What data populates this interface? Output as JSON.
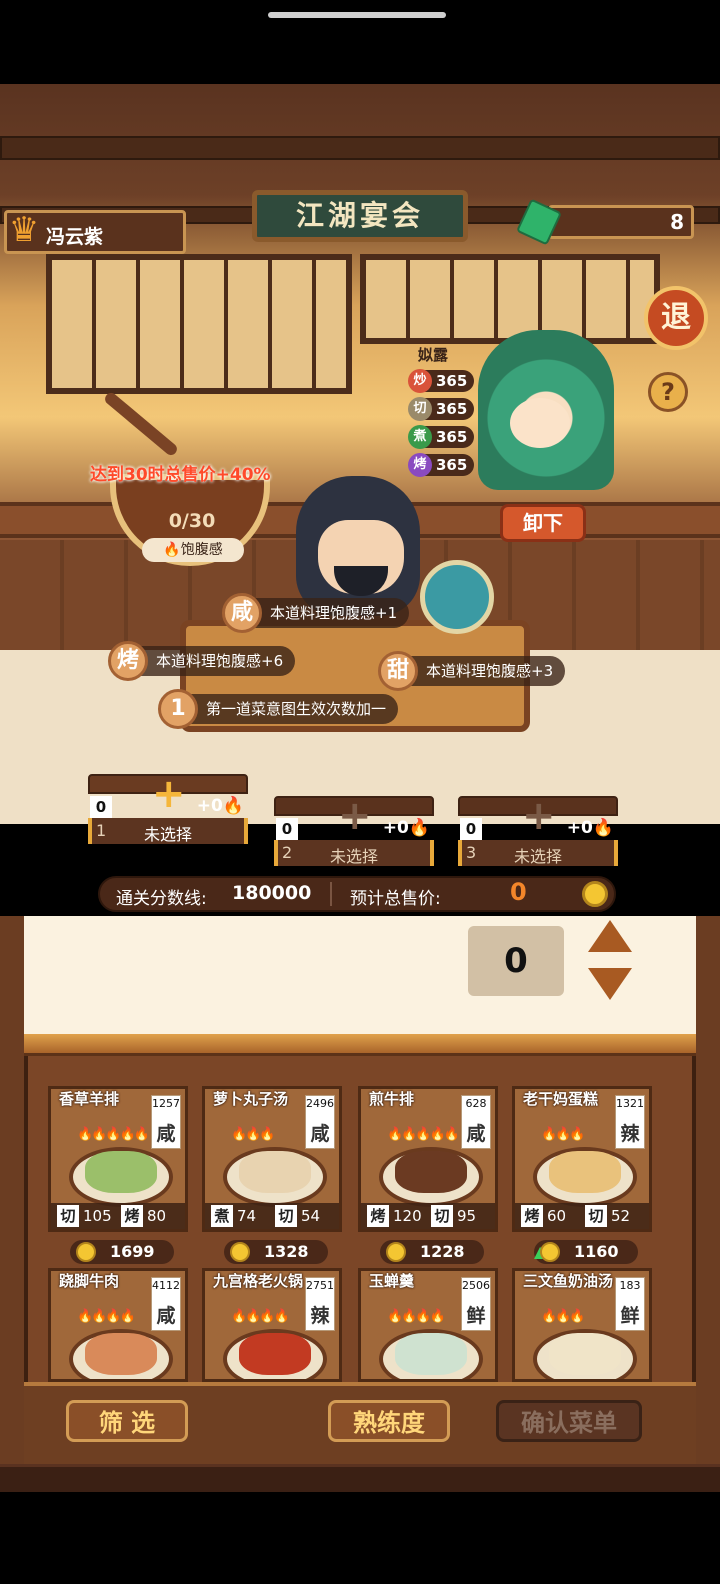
{
  "header": {
    "player_name": "冯云紫",
    "gem_count": "8",
    "sign_title": "江湖宴会",
    "exit_label": "退",
    "help_label": "?"
  },
  "character": {
    "name": "姒露",
    "skills": [
      {
        "icon": "炒",
        "value": "365",
        "color": "#d9533a"
      },
      {
        "icon": "切",
        "value": "365",
        "color": "#9a8a6a"
      },
      {
        "icon": "煮",
        "value": "365",
        "color": "#3a9a4a"
      },
      {
        "icon": "烤",
        "value": "365",
        "color": "#8a4ac0"
      }
    ],
    "remove_label": "卸下"
  },
  "satiety": {
    "bonus_text": "达到30时总售价+40%",
    "progress": "0/30",
    "label": "🔥饱腹感"
  },
  "buffs": [
    {
      "tag": "咸",
      "text": "本道料理饱腹感+1"
    },
    {
      "tag": "烤",
      "text": "本道料理饱腹感+6"
    },
    {
      "tag": "甜",
      "text": "本道料理饱腹感+3"
    },
    {
      "tag": "1",
      "text": "第一道菜意图生效次数加一"
    }
  ],
  "slots": [
    {
      "count": "0",
      "bonus": "+0🔥",
      "index": "1",
      "label": "未选择"
    },
    {
      "count": "0",
      "bonus": "+0🔥",
      "index": "2",
      "label": "未选择"
    },
    {
      "count": "0",
      "bonus": "+0🔥",
      "index": "3",
      "label": "未选择"
    }
  ],
  "score": {
    "threshold_label": "通关分数线:",
    "threshold_value": "180000",
    "price_label": "预计总售价:",
    "price_value": "0"
  },
  "quantity": "0",
  "dishes": [
    {
      "name": "香草羊排",
      "num": "1257",
      "flavor": "咸",
      "flames": "🔥🔥🔥🔥🔥",
      "s1": "切",
      "v1": "105",
      "s2": "烤",
      "v2": "80",
      "price": "1699",
      "food_color": "#9bbf6a",
      "up": false
    },
    {
      "name": "萝卜丸子汤",
      "num": "2496",
      "flavor": "咸",
      "flames": "🔥🔥🔥",
      "s1": "煮",
      "v1": "74",
      "s2": "切",
      "v2": "54",
      "price": "1328",
      "food_color": "#e8d3b0",
      "up": false
    },
    {
      "name": "煎牛排",
      "num": "628",
      "flavor": "咸",
      "flames": "🔥🔥🔥🔥🔥",
      "s1": "烤",
      "v1": "120",
      "s2": "切",
      "v2": "95",
      "price": "1228",
      "food_color": "#6b3a22",
      "up": false
    },
    {
      "name": "老干妈蛋糕",
      "num": "1321",
      "flavor": "辣",
      "flames": "🔥🔥🔥",
      "s1": "烤",
      "v1": "60",
      "s2": "切",
      "v2": "52",
      "price": "1160",
      "food_color": "#e9c27c",
      "up": true
    },
    {
      "name": "跷脚牛肉",
      "num": "4112",
      "flavor": "咸",
      "flames": "🔥🔥🔥🔥",
      "price": "",
      "food_color": "#d98a5a"
    },
    {
      "name": "九宫格老火锅",
      "num": "2751",
      "flavor": "辣",
      "flames": "🔥🔥🔥🔥",
      "price": "",
      "food_color": "#c23a22"
    },
    {
      "name": "玉蝉羹",
      "num": "2506",
      "flavor": "鲜",
      "flames": "🔥🔥🔥🔥",
      "price": "",
      "food_color": "#cfe2d0"
    },
    {
      "name": "三文鱼奶油汤",
      "num": "183",
      "flavor": "鲜",
      "flames": "🔥🔥🔥",
      "price": "",
      "food_color": "#f0e4c8"
    }
  ],
  "actions": {
    "filter": "筛 选",
    "mastery": "熟练度",
    "confirm": "确认菜单"
  }
}
